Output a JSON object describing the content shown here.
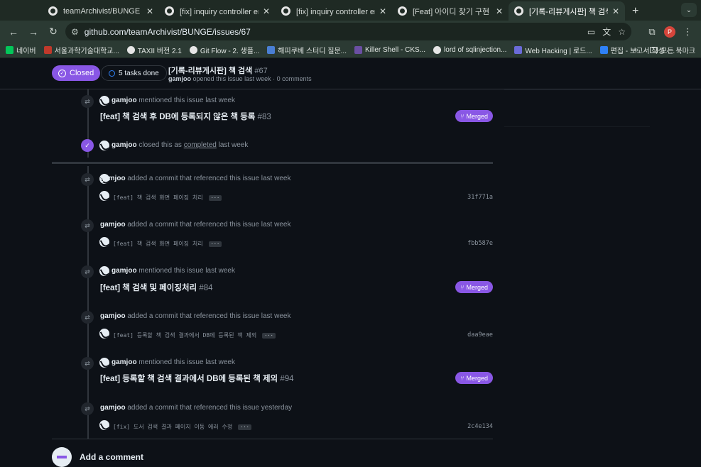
{
  "browser": {
    "tabs": [
      {
        "title": "teamArchivist/BUNGE",
        "active": false
      },
      {
        "title": "[fix] inquiry controller error 수",
        "active": false
      },
      {
        "title": "[fix] inquiry controller error 수",
        "active": false
      },
      {
        "title": "[Feat] 아이디 찾기 구현 수정 by ...",
        "active": false
      },
      {
        "title": "[기록-리뷰게시판] 책 검색 · Issue",
        "active": true
      }
    ],
    "new_tab": "+",
    "url": "github.com/teamArchivist/BUNGE/issues/67",
    "profile_initial": "P",
    "bookmarks": [
      {
        "label": "네이버",
        "color": "#03c75a"
      },
      {
        "label": "서울과학기술대학교...",
        "color": "#c0392b"
      },
      {
        "label": "TAXII 버전 2.1",
        "color": "#e6e6e6"
      },
      {
        "label": "Git Flow - 2. 생플...",
        "color": "#e6e6e6"
      },
      {
        "label": "해피쿠베 스터디 질문...",
        "color": "#4a7fd4"
      },
      {
        "label": "Killer Shell - CKS...",
        "color": "#6b4fa3"
      },
      {
        "label": "lord of sqlinjection...",
        "color": "#e6e6e6"
      },
      {
        "label": "Web Hacking | 로드...",
        "color": "#6b6bd8"
      },
      {
        "label": "편집 - 보고서 작성 -...",
        "color": "#2f81f7"
      }
    ],
    "bookmarks_more": "»",
    "all_bookmarks": "모든 북마크"
  },
  "header": {
    "state_label": "Closed",
    "tasks_label": "5 tasks done",
    "title": "[기록-리뷰게시판] 책 검색",
    "number": "#67",
    "author": "gamjoo",
    "meta": "opened this issue last week · 0 comments"
  },
  "timeline": {
    "e1": {
      "user": "gamjoo",
      "text": "mentioned this issue last week",
      "ref_title": "[feat] 책 검색 후 DB에 등록되지 않은 책 등록",
      "ref_num": "#83",
      "status": "Merged"
    },
    "e2": {
      "user": "gamjoo",
      "text_before": "closed this as",
      "link": "completed",
      "text_after": "last week"
    },
    "e3": {
      "user": "gamjoo",
      "text": "added a commit that referenced this issue last week",
      "commit": "[feat] 책 검색 화면 페이징 처리",
      "sha": "31f771a"
    },
    "e4": {
      "user": "gamjoo",
      "text": "added a commit that referenced this issue last week",
      "commit": "[feat] 책 검색 화면 페이징 처리",
      "sha": "fbb587e"
    },
    "e5": {
      "user": "gamjoo",
      "text": "mentioned this issue last week",
      "ref_title": "[feat] 책 검색 및 페이징처리",
      "ref_num": "#84",
      "status": "Merged"
    },
    "e6": {
      "user": "gamjoo",
      "text": "added a commit that referenced this issue last week",
      "commit": "[feat] 등록할 책 검색 결과에서 DB에 등록된 책 제외",
      "sha": "daa9eae"
    },
    "e7": {
      "user": "gamjoo",
      "text": "mentioned this issue last week",
      "ref_title": "[feat] 등록할 책 검색 결과에서 DB에 등록된 책 제외",
      "ref_num": "#94",
      "status": "Merged"
    },
    "e8": {
      "user": "gamjoo",
      "text": "added a commit that referenced this issue yesterday",
      "commit": "[fix] 도서 검색 결과 페이지 이동 에러 수정",
      "sha": "2c4e134"
    },
    "ellipsis": "···"
  },
  "add_comment": {
    "label": "Add a comment"
  },
  "colors": {
    "accent": "#8957e5",
    "bg": "#0d1117",
    "border": "#30363d"
  }
}
